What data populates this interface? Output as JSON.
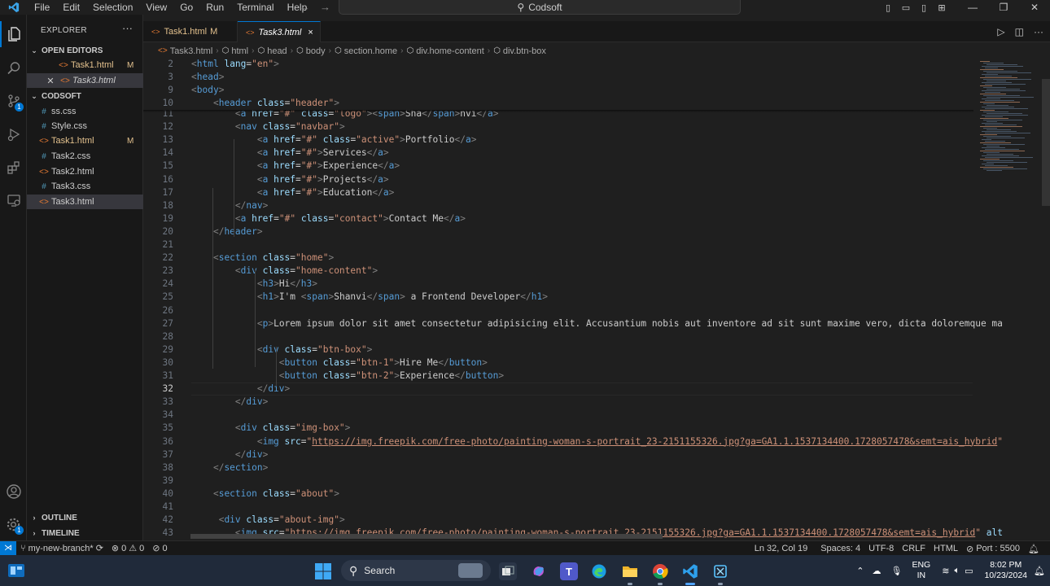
{
  "menu": [
    "File",
    "Edit",
    "Selection",
    "View",
    "Go",
    "Run",
    "Terminal",
    "Help"
  ],
  "command_center": {
    "label": "Codsoft"
  },
  "sidebar": {
    "title": "EXPLORER",
    "open_editors": {
      "header": "OPEN EDITORS",
      "items": [
        {
          "name": "Task1.html",
          "mark": "M"
        },
        {
          "name": "Task3.html",
          "mark": ""
        }
      ]
    },
    "folder": {
      "header": "CODSOFT",
      "items": [
        {
          "name": "ss.css",
          "icon": "#",
          "mark": ""
        },
        {
          "name": "Style.css",
          "icon": "#",
          "mark": ""
        },
        {
          "name": "Task1.html",
          "icon": "<>",
          "mark": "M"
        },
        {
          "name": "Task2.css",
          "icon": "#",
          "mark": ""
        },
        {
          "name": "Task2.html",
          "icon": "<>",
          "mark": ""
        },
        {
          "name": "Task3.css",
          "icon": "#",
          "mark": ""
        },
        {
          "name": "Task3.html",
          "icon": "<>",
          "mark": ""
        }
      ]
    },
    "outline": "OUTLINE",
    "timeline": "TIMELINE"
  },
  "tabs": [
    {
      "name": "Task1.html",
      "mark": "M"
    },
    {
      "name": "Task3.html",
      "mark": "×"
    }
  ],
  "breadcrumb": [
    "Task3.html",
    "html",
    "head",
    "body",
    "section.home",
    "div.home-content",
    "div.btn-box"
  ],
  "editor": {
    "sticky_lines": [
      {
        "num": "2",
        "code": "<html lang=\"en\">"
      },
      {
        "num": "3",
        "code": "<head>"
      },
      {
        "num": "9",
        "code": "<body>"
      },
      {
        "num": "10",
        "code": "    <header class=\"header\">"
      }
    ],
    "lines": [
      {
        "num": "11",
        "code": "        <a href=\"#\" class=\"logo\"><span>Sha</span>nvi</a>"
      },
      {
        "num": "12",
        "code": "        <nav class=\"navbar\">"
      },
      {
        "num": "13",
        "code": "            <a href=\"#\" class=\"active\">Portfolio</a>"
      },
      {
        "num": "14",
        "code": "            <a href=\"#\">Services</a>"
      },
      {
        "num": "15",
        "code": "            <a href=\"#\">Experience</a>"
      },
      {
        "num": "16",
        "code": "            <a href=\"#\">Projects</a>"
      },
      {
        "num": "17",
        "code": "            <a href=\"#\">Education</a>"
      },
      {
        "num": "18",
        "code": "        </nav>"
      },
      {
        "num": "19",
        "code": "        <a href=\"#\" class=\"contact\">Contact Me</a>"
      },
      {
        "num": "20",
        "code": "    </header>"
      },
      {
        "num": "21",
        "code": ""
      },
      {
        "num": "22",
        "code": "    <section class=\"home\">"
      },
      {
        "num": "23",
        "code": "        <div class=\"home-content\">"
      },
      {
        "num": "24",
        "code": "            <h3>Hi</h3>"
      },
      {
        "num": "25",
        "code": "            <h1>I'm <span>Shanvi</span> a Frontend Developer</h1>"
      },
      {
        "num": "26",
        "code": ""
      },
      {
        "num": "27",
        "code": "            <p>Lorem ipsum dolor sit amet consectetur adipisicing elit. Accusantium nobis aut inventore ad sit sunt maxime vero, dicta doloremque ma"
      },
      {
        "num": "28",
        "code": ""
      },
      {
        "num": "29",
        "code": "            <div class=\"btn-box\">"
      },
      {
        "num": "30",
        "code": "                <button class=\"btn-1\">Hire Me</button>"
      },
      {
        "num": "31",
        "code": "                <button class=\"btn-2\">Experience</button>"
      },
      {
        "num": "32",
        "code": "            </div>"
      },
      {
        "num": "33",
        "code": "        </div>"
      },
      {
        "num": "34",
        "code": ""
      },
      {
        "num": "35",
        "code": "        <div class=\"img-box\">"
      },
      {
        "num": "36",
        "code": "            <img src=\"https://img.freepik.com/free-photo/painting-woman-s-portrait_23-2151155326.jpg?ga=GA1.1.1537134400.1728057478&semt=ais_hybrid\""
      },
      {
        "num": "37",
        "code": "        </div>"
      },
      {
        "num": "38",
        "code": "    </section>"
      },
      {
        "num": "39",
        "code": ""
      },
      {
        "num": "40",
        "code": "    <section class=\"about\">"
      },
      {
        "num": "41",
        "code": ""
      },
      {
        "num": "42",
        "code": "     <div class=\"about-img\">"
      },
      {
        "num": "43",
        "code": "        <img src=\"https://img.freepik.com/free-photo/painting-woman-s-portrait_23-2151155326.jpg?ga=GA1.1.1537134400.1728057478&semt=ais_hybrid\" alt"
      }
    ],
    "current_line": "32"
  },
  "status": {
    "branch": "my-new-branch*",
    "errors": "0",
    "warnings": "0",
    "ports_count": "0",
    "position": "Ln 32, Col 19",
    "spaces": "Spaces: 4",
    "encoding": "UTF-8",
    "eol": "CRLF",
    "language": "HTML",
    "port": "Port : 5500"
  },
  "taskbar": {
    "search_placeholder": "Search",
    "lang_top": "ENG",
    "lang_bottom": "IN",
    "time": "8:02 PM",
    "date": "10/23/2024"
  },
  "colors": {
    "accent": "#0078d4",
    "tag": "#569cd6",
    "attr": "#9cdcfe",
    "string": "#ce9178"
  }
}
